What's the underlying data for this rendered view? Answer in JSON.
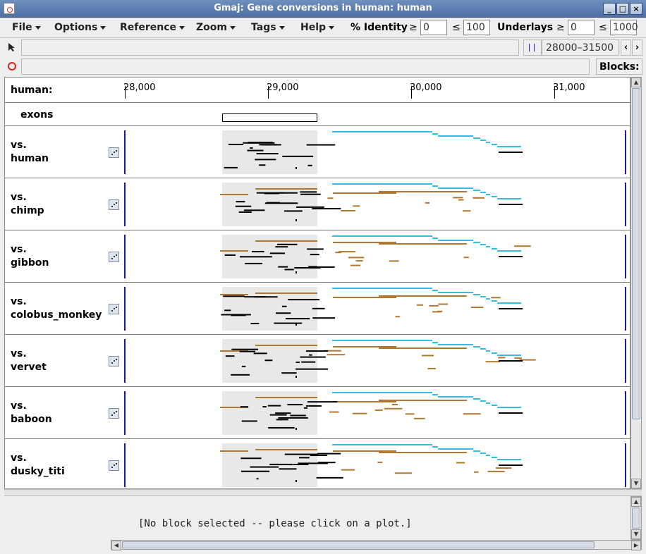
{
  "window": {
    "title": "Gmaj: Gene conversions in human: human"
  },
  "menus": [
    "File",
    "Options",
    "Reference",
    "Zoom",
    "Tags",
    "Help"
  ],
  "filters": {
    "identity_label": "% Identity",
    "identity_min": "0",
    "identity_max": "100",
    "underlays_label": "Underlays",
    "underlays_min": "0",
    "underlays_max": "1000",
    "ge": "≥",
    "le": "≤"
  },
  "toolbar": {
    "range_label": "28000–31500",
    "blocks_label": "Blocks:"
  },
  "ruler": {
    "reference": "human:",
    "ticks": [
      "28,000",
      "29,000",
      "30,000",
      "31,000"
    ]
  },
  "exons_label": "exons",
  "panes": [
    {
      "line1": "vs.",
      "line2": "human"
    },
    {
      "line1": "vs.",
      "line2": "chimp"
    },
    {
      "line1": "vs.",
      "line2": "gibbon"
    },
    {
      "line1": "vs.",
      "line2": "colobus_monkey"
    },
    {
      "line1": "vs.",
      "line2": "vervet"
    },
    {
      "line1": "vs.",
      "line2": "baboon"
    },
    {
      "line1": "vs.",
      "line2": "dusky_titi"
    }
  ],
  "status": "[No block selected -- please click on a plot.]",
  "colors": {
    "conversion": "#33c0e0",
    "alignment": "#b07830",
    "block": "#000000",
    "underlay": "#e8e8e8",
    "marker": "#1a1a9a"
  }
}
